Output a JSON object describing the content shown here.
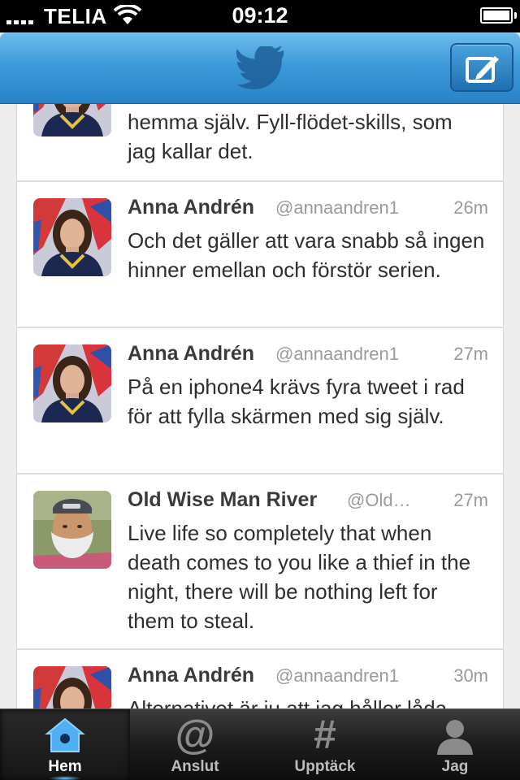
{
  "status_bar": {
    "carrier": "TELIA",
    "time": "09:12"
  },
  "nav": {
    "logo_icon": "twitter-bird-icon",
    "compose_icon": "compose-icon"
  },
  "colors": {
    "nav_blue": "#3d9ad9",
    "tab_active_glow": "#6fc3ff"
  },
  "timeline": {
    "partial_tweet": {
      "text": "hemma själv. Fyll-flödet-skills, som jag kallar det."
    },
    "tweets": [
      {
        "name": "Anna Andrén",
        "handle": "@annaandren1",
        "time": "26m",
        "text": "Och det gäller att vara snabb så ingen hinner emellan och förstör serien."
      },
      {
        "name": "Anna Andrén",
        "handle": "@annaandren1",
        "time": "27m",
        "text": "På en iphone4 krävs fyra tweet i rad för att fylla skärmen med sig själv."
      },
      {
        "name": "Old Wise Man River",
        "handle": "@Old…",
        "time": "27m",
        "text": "Live life so completely that when death comes to you like a thief in the night, there will be nothing left for them to steal."
      },
      {
        "name": "Anna Andrén",
        "handle": "@annaandren1",
        "time": "30m",
        "text": "Alternativet är ju att jag håller låda"
      }
    ]
  },
  "tabbar": {
    "tabs": [
      {
        "label": "Hem",
        "icon": "home-birdhouse-icon",
        "active": true
      },
      {
        "label": "Anslut",
        "icon": "at-sign-icon",
        "glyph": "@"
      },
      {
        "label": "Upptäck",
        "icon": "hashtag-icon",
        "glyph": "#"
      },
      {
        "label": "Jag",
        "icon": "person-icon"
      }
    ]
  }
}
